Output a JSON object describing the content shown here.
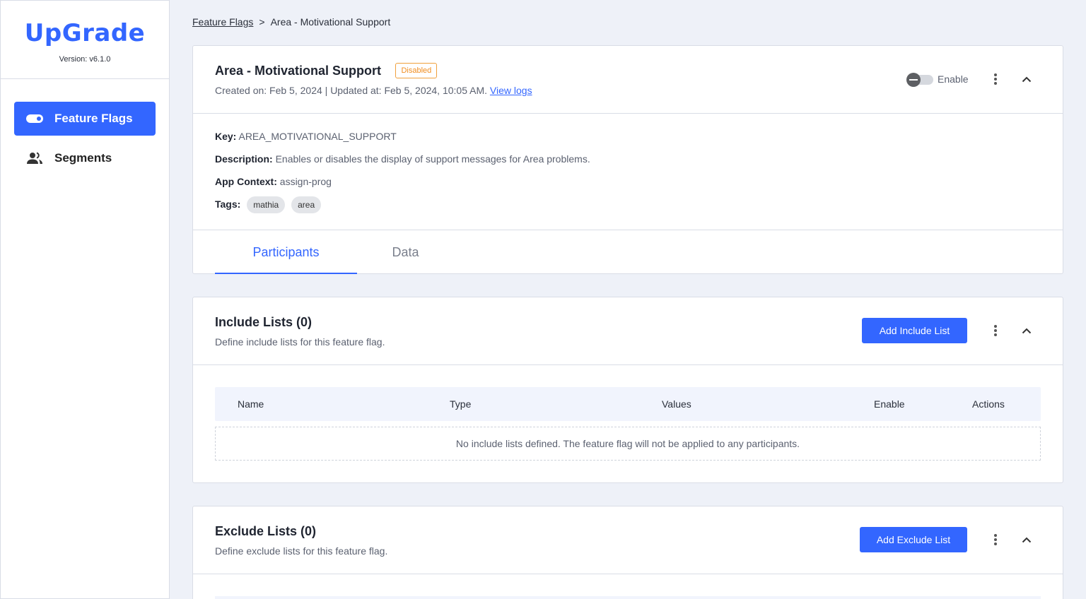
{
  "app": {
    "name": "UpGrade",
    "version": "Version: v6.1.0"
  },
  "sidebar": {
    "items": [
      {
        "label": "Feature Flags",
        "icon": "toggle-icon",
        "active": true
      },
      {
        "label": "Segments",
        "icon": "people-icon",
        "active": false
      }
    ]
  },
  "breadcrumb": {
    "parent": "Feature Flags",
    "separator": ">",
    "current": "Area - Motivational Support"
  },
  "flag": {
    "title": "Area - Motivational Support",
    "status_badge": "Disabled",
    "timestamps": "Created on: Feb 5, 2024 | Updated at: Feb 5, 2024, 10:05 AM.",
    "view_logs": "View logs",
    "enable_label": "Enable",
    "enabled": false,
    "key_label": "Key:",
    "key_value": "AREA_MOTIVATIONAL_SUPPORT",
    "description_label": "Description:",
    "description_value": "Enables or disables the display of support messages for Area problems.",
    "context_label": "App Context:",
    "context_value": "assign-prog",
    "tags_label": "Tags:",
    "tags": [
      "mathia",
      "area"
    ]
  },
  "tabs": [
    {
      "label": "Participants",
      "active": true
    },
    {
      "label": "Data",
      "active": false
    }
  ],
  "include": {
    "title": "Include Lists (0)",
    "subtitle": "Define include lists for this feature flag.",
    "button": "Add Include List",
    "columns": [
      "Name",
      "Type",
      "Values",
      "Enable",
      "Actions"
    ],
    "empty": "No include lists defined. The feature flag will not be applied to any participants."
  },
  "exclude": {
    "title": "Exclude Lists (0)",
    "subtitle": "Define exclude lists for this feature flag.",
    "button": "Add Exclude List"
  },
  "colors": {
    "accent": "#3366ff",
    "badge": "#f08c1e",
    "background": "#eef1f8"
  }
}
